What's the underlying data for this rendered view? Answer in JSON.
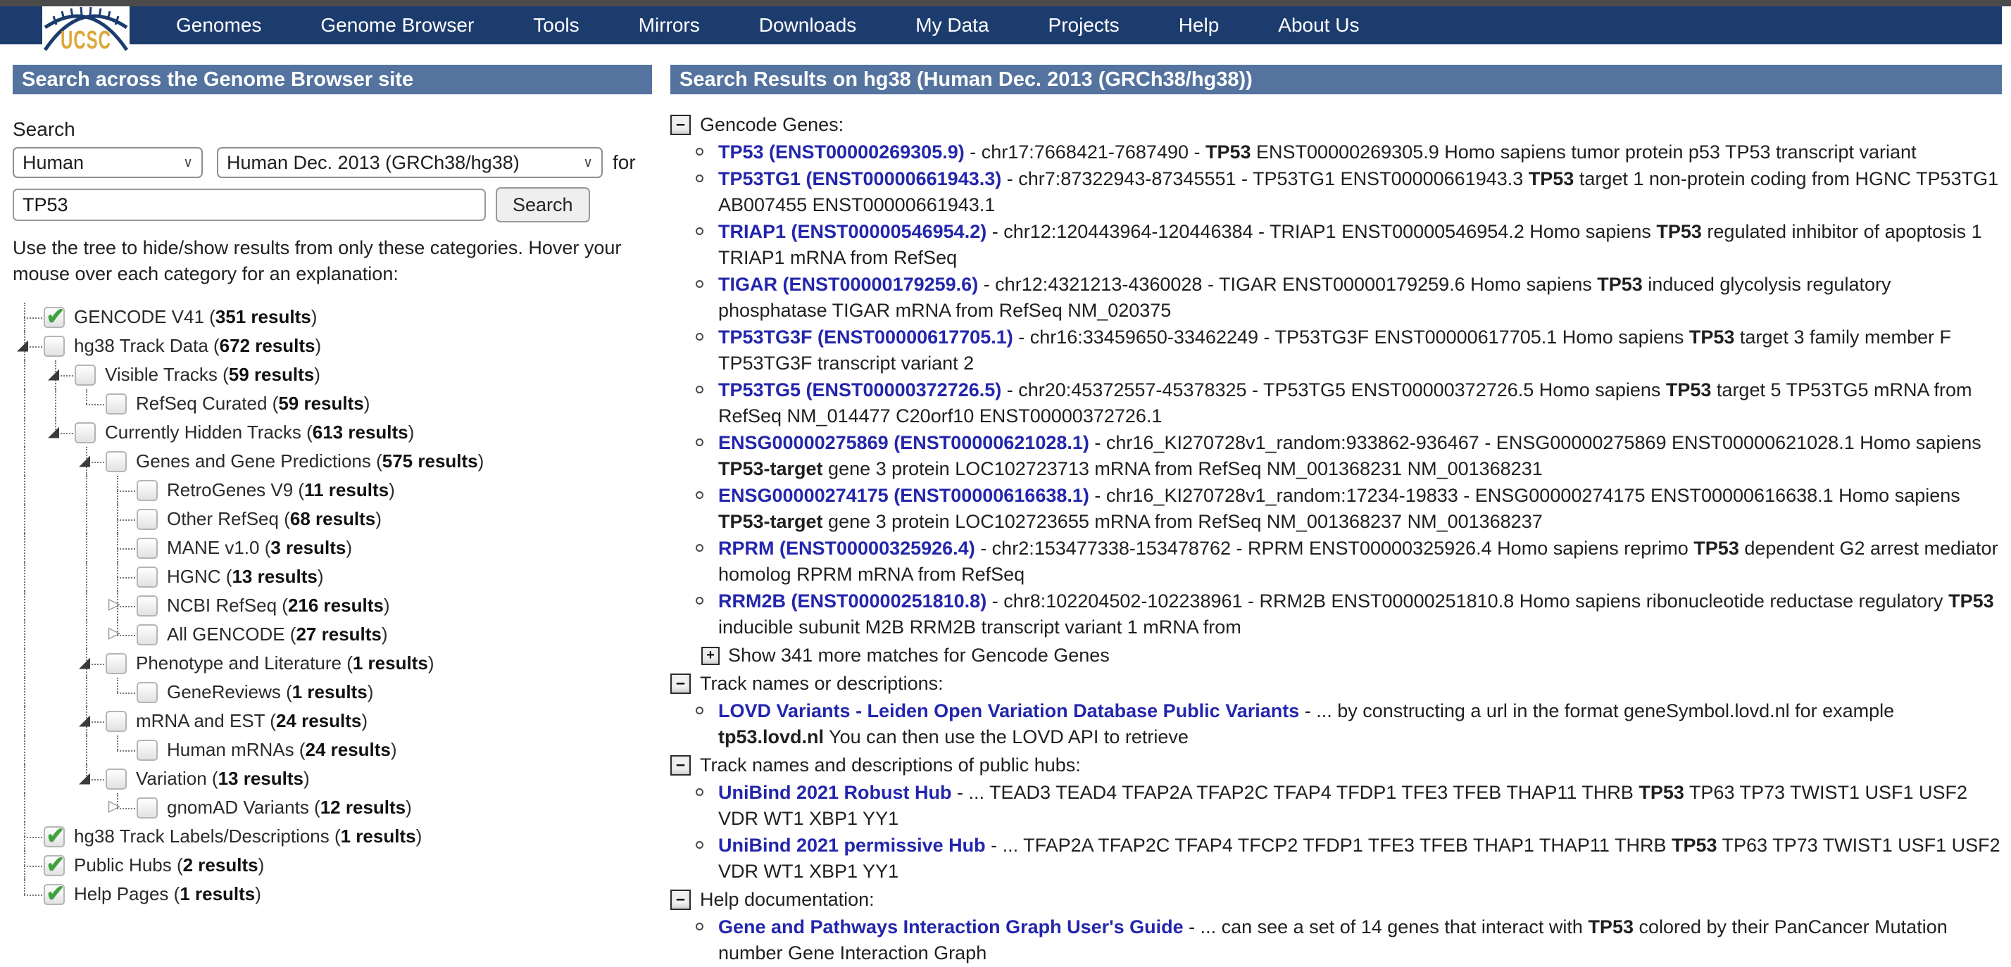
{
  "colors": {
    "navy": "#1d3c6e",
    "slate": "#54739e",
    "link": "#2326ac",
    "green": "#3da33c",
    "gold": "#dda83a"
  },
  "logo": {
    "text": "UCSC"
  },
  "topbar": {
    "items": [
      "Genomes",
      "Genome Browser",
      "Tools",
      "Mirrors",
      "Downloads",
      "My Data",
      "Projects",
      "Help",
      "About Us"
    ]
  },
  "left": {
    "header": "Search across the Genome Browser site",
    "search_label": "Search",
    "species_select": "Human",
    "assembly_select": "Human Dec. 2013 (GRCh38/hg38)",
    "for_label": "for",
    "search_value": "TP53",
    "search_button": "Search",
    "instructions": "Use the tree to hide/show results from only these categories. Hover your mouse over each category for an explanation:",
    "results_word": "results",
    "tree": [
      {
        "label": "GENCODE V41",
        "count": "351",
        "level": 0,
        "checked": true,
        "arrow": "none"
      },
      {
        "label": "hg38 Track Data",
        "count": "672",
        "level": 0,
        "checked": false,
        "arrow": "expanded"
      },
      {
        "label": "Visible Tracks",
        "count": "59",
        "level": 1,
        "checked": false,
        "arrow": "expanded"
      },
      {
        "label": "RefSeq Curated",
        "count": "59",
        "level": 2,
        "checked": false,
        "arrow": "none"
      },
      {
        "label": "Currently Hidden Tracks",
        "count": "613",
        "level": 1,
        "checked": false,
        "arrow": "expanded"
      },
      {
        "label": "Genes and Gene Predictions",
        "count": "575",
        "level": 2,
        "checked": false,
        "arrow": "expanded"
      },
      {
        "label": "RetroGenes V9",
        "count": "11",
        "level": 3,
        "checked": false,
        "arrow": "none"
      },
      {
        "label": "Other RefSeq",
        "count": "68",
        "level": 3,
        "checked": false,
        "arrow": "none"
      },
      {
        "label": "MANE v1.0",
        "count": "3",
        "level": 3,
        "checked": false,
        "arrow": "none"
      },
      {
        "label": "HGNC",
        "count": "13",
        "level": 3,
        "checked": false,
        "arrow": "none"
      },
      {
        "label": "NCBI RefSeq",
        "count": "216",
        "level": 3,
        "checked": false,
        "arrow": "collapsed"
      },
      {
        "label": "All GENCODE",
        "count": "27",
        "level": 3,
        "checked": false,
        "arrow": "collapsed"
      },
      {
        "label": "Phenotype and Literature",
        "count": "1",
        "level": 2,
        "checked": false,
        "arrow": "expanded"
      },
      {
        "label": "GeneReviews",
        "count": "1",
        "level": 3,
        "checked": false,
        "arrow": "none"
      },
      {
        "label": "mRNA and EST",
        "count": "24",
        "level": 2,
        "checked": false,
        "arrow": "expanded"
      },
      {
        "label": "Human mRNAs",
        "count": "24",
        "level": 3,
        "checked": false,
        "arrow": "none"
      },
      {
        "label": "Variation",
        "count": "13",
        "level": 2,
        "checked": false,
        "arrow": "expanded"
      },
      {
        "label": "gnomAD Variants",
        "count": "12",
        "level": 3,
        "checked": false,
        "arrow": "collapsed"
      },
      {
        "label": "hg38 Track Labels/Descriptions",
        "count": "1",
        "level": 0,
        "checked": true,
        "arrow": "none"
      },
      {
        "label": "Public Hubs",
        "count": "2",
        "level": 0,
        "checked": true,
        "arrow": "none"
      },
      {
        "label": "Help Pages",
        "count": "1",
        "level": 0,
        "checked": true,
        "arrow": "none"
      }
    ]
  },
  "right": {
    "header": "Search Results on hg38 (Human Dec. 2013 (GRCh38/hg38))",
    "sections": [
      {
        "toggle": "−",
        "title": "Gencode Genes:",
        "items": [
          {
            "link": "TP53 (ENST00000269305.9)",
            "segments": [
              {
                "t": " - chr17:7668421-7687490 - "
              },
              {
                "t": "TP53",
                "b": true
              },
              {
                "t": " ENST00000269305.9 Homo sapiens tumor protein p53 TP53 transcript variant"
              }
            ]
          },
          {
            "link": "TP53TG1 (ENST00000661943.3)",
            "segments": [
              {
                "t": " - chr7:87322943-87345551 - TP53TG1 ENST00000661943.3 "
              },
              {
                "t": "TP53",
                "b": true
              },
              {
                "t": " target 1 non-protein coding from HGNC TP53TG1 AB007455 ENST00000661943.1"
              }
            ]
          },
          {
            "link": "TRIAP1 (ENST00000546954.2)",
            "segments": [
              {
                "t": " - chr12:120443964-120446384 - TRIAP1 ENST00000546954.2 Homo sapiens "
              },
              {
                "t": "TP53",
                "b": true
              },
              {
                "t": " regulated inhibitor of apoptosis 1 TRIAP1 mRNA from RefSeq"
              }
            ]
          },
          {
            "link": "TIGAR (ENST00000179259.6)",
            "segments": [
              {
                "t": " - chr12:4321213-4360028 - TIGAR ENST00000179259.6 Homo sapiens "
              },
              {
                "t": "TP53",
                "b": true
              },
              {
                "t": " induced glycolysis regulatory phosphatase TIGAR mRNA from RefSeq NM_020375"
              }
            ]
          },
          {
            "link": "TP53TG3F (ENST00000617705.1)",
            "segments": [
              {
                "t": " - chr16:33459650-33462249 - TP53TG3F ENST00000617705.1 Homo sapiens "
              },
              {
                "t": "TP53",
                "b": true
              },
              {
                "t": " target 3 family member F TP53TG3F transcript variant 2"
              }
            ]
          },
          {
            "link": "TP53TG5 (ENST00000372726.5)",
            "segments": [
              {
                "t": " - chr20:45372557-45378325 - TP53TG5 ENST00000372726.5 Homo sapiens "
              },
              {
                "t": "TP53",
                "b": true
              },
              {
                "t": " target 5 TP53TG5 mRNA from RefSeq NM_014477 C20orf10 ENST00000372726.1"
              }
            ]
          },
          {
            "link": "ENSG00000275869 (ENST00000621028.1)",
            "segments": [
              {
                "t": " - chr16_KI270728v1_random:933862-936467 - ENSG00000275869 ENST00000621028.1 Homo sapiens "
              },
              {
                "t": "TP53-target",
                "b": true
              },
              {
                "t": " gene 3 protein LOC102723713 mRNA from RefSeq NM_001368231 NM_001368231"
              }
            ]
          },
          {
            "link": "ENSG00000274175 (ENST00000616638.1)",
            "segments": [
              {
                "t": " - chr16_KI270728v1_random:17234-19833 - ENSG00000274175 ENST00000616638.1 Homo sapiens "
              },
              {
                "t": "TP53-target",
                "b": true
              },
              {
                "t": " gene 3 protein LOC102723655 mRNA from RefSeq NM_001368237 NM_001368237"
              }
            ]
          },
          {
            "link": "RPRM (ENST00000325926.4)",
            "segments": [
              {
                "t": " - chr2:153477338-153478762 - RPRM ENST00000325926.4 Homo sapiens reprimo "
              },
              {
                "t": "TP53",
                "b": true
              },
              {
                "t": " dependent G2 arrest mediator homolog RPRM mRNA from RefSeq"
              }
            ]
          },
          {
            "link": "RRM2B (ENST00000251810.8)",
            "segments": [
              {
                "t": " - chr8:102204502-102238961 - RRM2B ENST00000251810.8 Homo sapiens ribonucleotide reductase regulatory "
              },
              {
                "t": "TP53",
                "b": true
              },
              {
                "t": " inducible subunit M2B RRM2B transcript variant 1 mRNA from"
              }
            ]
          }
        ],
        "more": {
          "toggle": "+",
          "label": "Show 341 more matches for Gencode Genes"
        }
      },
      {
        "toggle": "−",
        "title": "Track names or descriptions:",
        "items": [
          {
            "link": "LOVD Variants - Leiden Open Variation Database Public Variants",
            "segments": [
              {
                "t": " - ... by constructing a url in the format geneSymbol.lovd.nl for example "
              },
              {
                "t": "tp53.lovd.nl",
                "b": true
              },
              {
                "t": " You can then use the LOVD API to retrieve"
              }
            ]
          }
        ]
      },
      {
        "toggle": "−",
        "title": "Track names and descriptions of public hubs:",
        "items": [
          {
            "link": "UniBind 2021 Robust Hub",
            "segments": [
              {
                "t": " - ... TEAD3 TEAD4 TFAP2A TFAP2C TFAP4 TFDP1 TFE3 TFEB THAP11 THRB "
              },
              {
                "t": "TP53",
                "b": true
              },
              {
                "t": " TP63 TP73 TWIST1 USF1 USF2 VDR WT1 XBP1 YY1"
              }
            ]
          },
          {
            "link": "UniBind 2021 permissive Hub",
            "segments": [
              {
                "t": " - ... TFAP2A TFAP2C TFAP4 TFCP2 TFDP1 TFE3 TFEB THAP1 THAP11 THRB "
              },
              {
                "t": "TP53",
                "b": true
              },
              {
                "t": " TP63 TP73 TWIST1 USF1 USF2 VDR WT1 XBP1 YY1"
              }
            ]
          }
        ]
      },
      {
        "toggle": "−",
        "title": "Help documentation:",
        "items": [
          {
            "link": "Gene and Pathways Interaction Graph User's Guide",
            "segments": [
              {
                "t": " - ... can see a set of 14 genes that interact with "
              },
              {
                "t": "TP53",
                "b": true
              },
              {
                "t": " colored by their PanCancer Mutation number Gene Interaction Graph"
              }
            ]
          }
        ]
      }
    ]
  }
}
